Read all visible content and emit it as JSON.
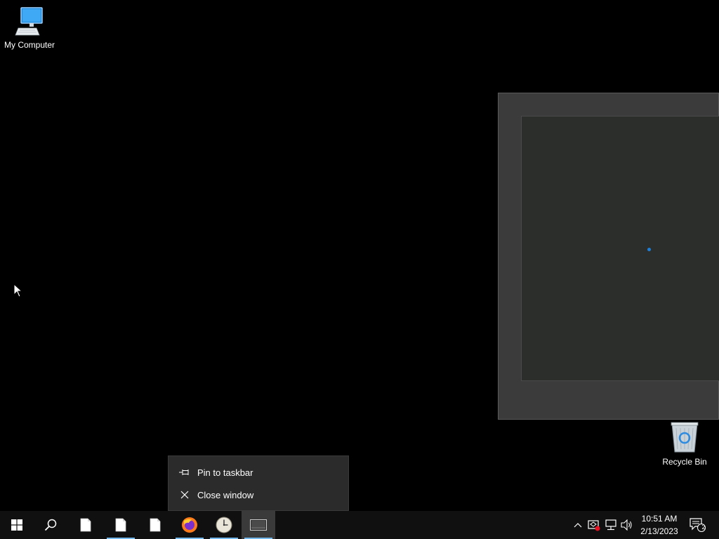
{
  "desktop": {
    "icons": [
      {
        "label": "My Computer",
        "icon": "computer-icon"
      },
      {
        "label": "Recycle Bin",
        "icon": "recycle-bin-icon"
      }
    ]
  },
  "jump_menu": {
    "items": [
      {
        "label": "Pin to taskbar",
        "icon": "pin-icon"
      },
      {
        "label": "Close window",
        "icon": "close-icon"
      }
    ]
  },
  "taskbar": {
    "buttons": [
      {
        "icon": "windows-start-icon"
      },
      {
        "icon": "search-icon"
      },
      {
        "icon": "file-icon"
      },
      {
        "icon": "file-icon",
        "running": true
      },
      {
        "icon": "file-icon"
      },
      {
        "icon": "firefox-icon",
        "running": true
      },
      {
        "icon": "clock-icon",
        "running": true
      },
      {
        "icon": "app-window-icon",
        "running": true,
        "active": true
      }
    ],
    "tray": {
      "icons": [
        "chevron-up-icon",
        "security-icon",
        "network-icon",
        "volume-icon"
      ],
      "time": "10:51 AM",
      "date": "2/13/2023",
      "notification_count": "2"
    }
  },
  "colors": {
    "desktop_bg": "#000000",
    "taskbar_bg": "#101010",
    "accent": "#76b9ed",
    "window_bg": "#3b3b3b"
  }
}
